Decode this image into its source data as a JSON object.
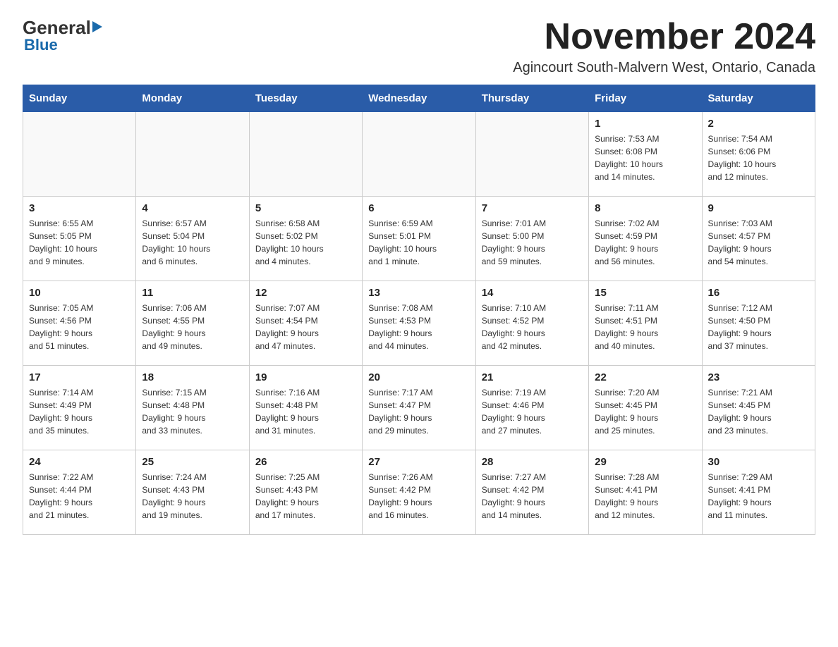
{
  "logo": {
    "general": "General",
    "blue": "Blue",
    "subtext": "Blue"
  },
  "header": {
    "month_year": "November 2024",
    "location": "Agincourt South-Malvern West, Ontario, Canada"
  },
  "weekdays": [
    "Sunday",
    "Monday",
    "Tuesday",
    "Wednesday",
    "Thursday",
    "Friday",
    "Saturday"
  ],
  "weeks": [
    [
      {
        "day": "",
        "info": ""
      },
      {
        "day": "",
        "info": ""
      },
      {
        "day": "",
        "info": ""
      },
      {
        "day": "",
        "info": ""
      },
      {
        "day": "",
        "info": ""
      },
      {
        "day": "1",
        "info": "Sunrise: 7:53 AM\nSunset: 6:08 PM\nDaylight: 10 hours\nand 14 minutes."
      },
      {
        "day": "2",
        "info": "Sunrise: 7:54 AM\nSunset: 6:06 PM\nDaylight: 10 hours\nand 12 minutes."
      }
    ],
    [
      {
        "day": "3",
        "info": "Sunrise: 6:55 AM\nSunset: 5:05 PM\nDaylight: 10 hours\nand 9 minutes."
      },
      {
        "day": "4",
        "info": "Sunrise: 6:57 AM\nSunset: 5:04 PM\nDaylight: 10 hours\nand 6 minutes."
      },
      {
        "day": "5",
        "info": "Sunrise: 6:58 AM\nSunset: 5:02 PM\nDaylight: 10 hours\nand 4 minutes."
      },
      {
        "day": "6",
        "info": "Sunrise: 6:59 AM\nSunset: 5:01 PM\nDaylight: 10 hours\nand 1 minute."
      },
      {
        "day": "7",
        "info": "Sunrise: 7:01 AM\nSunset: 5:00 PM\nDaylight: 9 hours\nand 59 minutes."
      },
      {
        "day": "8",
        "info": "Sunrise: 7:02 AM\nSunset: 4:59 PM\nDaylight: 9 hours\nand 56 minutes."
      },
      {
        "day": "9",
        "info": "Sunrise: 7:03 AM\nSunset: 4:57 PM\nDaylight: 9 hours\nand 54 minutes."
      }
    ],
    [
      {
        "day": "10",
        "info": "Sunrise: 7:05 AM\nSunset: 4:56 PM\nDaylight: 9 hours\nand 51 minutes."
      },
      {
        "day": "11",
        "info": "Sunrise: 7:06 AM\nSunset: 4:55 PM\nDaylight: 9 hours\nand 49 minutes."
      },
      {
        "day": "12",
        "info": "Sunrise: 7:07 AM\nSunset: 4:54 PM\nDaylight: 9 hours\nand 47 minutes."
      },
      {
        "day": "13",
        "info": "Sunrise: 7:08 AM\nSunset: 4:53 PM\nDaylight: 9 hours\nand 44 minutes."
      },
      {
        "day": "14",
        "info": "Sunrise: 7:10 AM\nSunset: 4:52 PM\nDaylight: 9 hours\nand 42 minutes."
      },
      {
        "day": "15",
        "info": "Sunrise: 7:11 AM\nSunset: 4:51 PM\nDaylight: 9 hours\nand 40 minutes."
      },
      {
        "day": "16",
        "info": "Sunrise: 7:12 AM\nSunset: 4:50 PM\nDaylight: 9 hours\nand 37 minutes."
      }
    ],
    [
      {
        "day": "17",
        "info": "Sunrise: 7:14 AM\nSunset: 4:49 PM\nDaylight: 9 hours\nand 35 minutes."
      },
      {
        "day": "18",
        "info": "Sunrise: 7:15 AM\nSunset: 4:48 PM\nDaylight: 9 hours\nand 33 minutes."
      },
      {
        "day": "19",
        "info": "Sunrise: 7:16 AM\nSunset: 4:48 PM\nDaylight: 9 hours\nand 31 minutes."
      },
      {
        "day": "20",
        "info": "Sunrise: 7:17 AM\nSunset: 4:47 PM\nDaylight: 9 hours\nand 29 minutes."
      },
      {
        "day": "21",
        "info": "Sunrise: 7:19 AM\nSunset: 4:46 PM\nDaylight: 9 hours\nand 27 minutes."
      },
      {
        "day": "22",
        "info": "Sunrise: 7:20 AM\nSunset: 4:45 PM\nDaylight: 9 hours\nand 25 minutes."
      },
      {
        "day": "23",
        "info": "Sunrise: 7:21 AM\nSunset: 4:45 PM\nDaylight: 9 hours\nand 23 minutes."
      }
    ],
    [
      {
        "day": "24",
        "info": "Sunrise: 7:22 AM\nSunset: 4:44 PM\nDaylight: 9 hours\nand 21 minutes."
      },
      {
        "day": "25",
        "info": "Sunrise: 7:24 AM\nSunset: 4:43 PM\nDaylight: 9 hours\nand 19 minutes."
      },
      {
        "day": "26",
        "info": "Sunrise: 7:25 AM\nSunset: 4:43 PM\nDaylight: 9 hours\nand 17 minutes."
      },
      {
        "day": "27",
        "info": "Sunrise: 7:26 AM\nSunset: 4:42 PM\nDaylight: 9 hours\nand 16 minutes."
      },
      {
        "day": "28",
        "info": "Sunrise: 7:27 AM\nSunset: 4:42 PM\nDaylight: 9 hours\nand 14 minutes."
      },
      {
        "day": "29",
        "info": "Sunrise: 7:28 AM\nSunset: 4:41 PM\nDaylight: 9 hours\nand 12 minutes."
      },
      {
        "day": "30",
        "info": "Sunrise: 7:29 AM\nSunset: 4:41 PM\nDaylight: 9 hours\nand 11 minutes."
      }
    ]
  ]
}
